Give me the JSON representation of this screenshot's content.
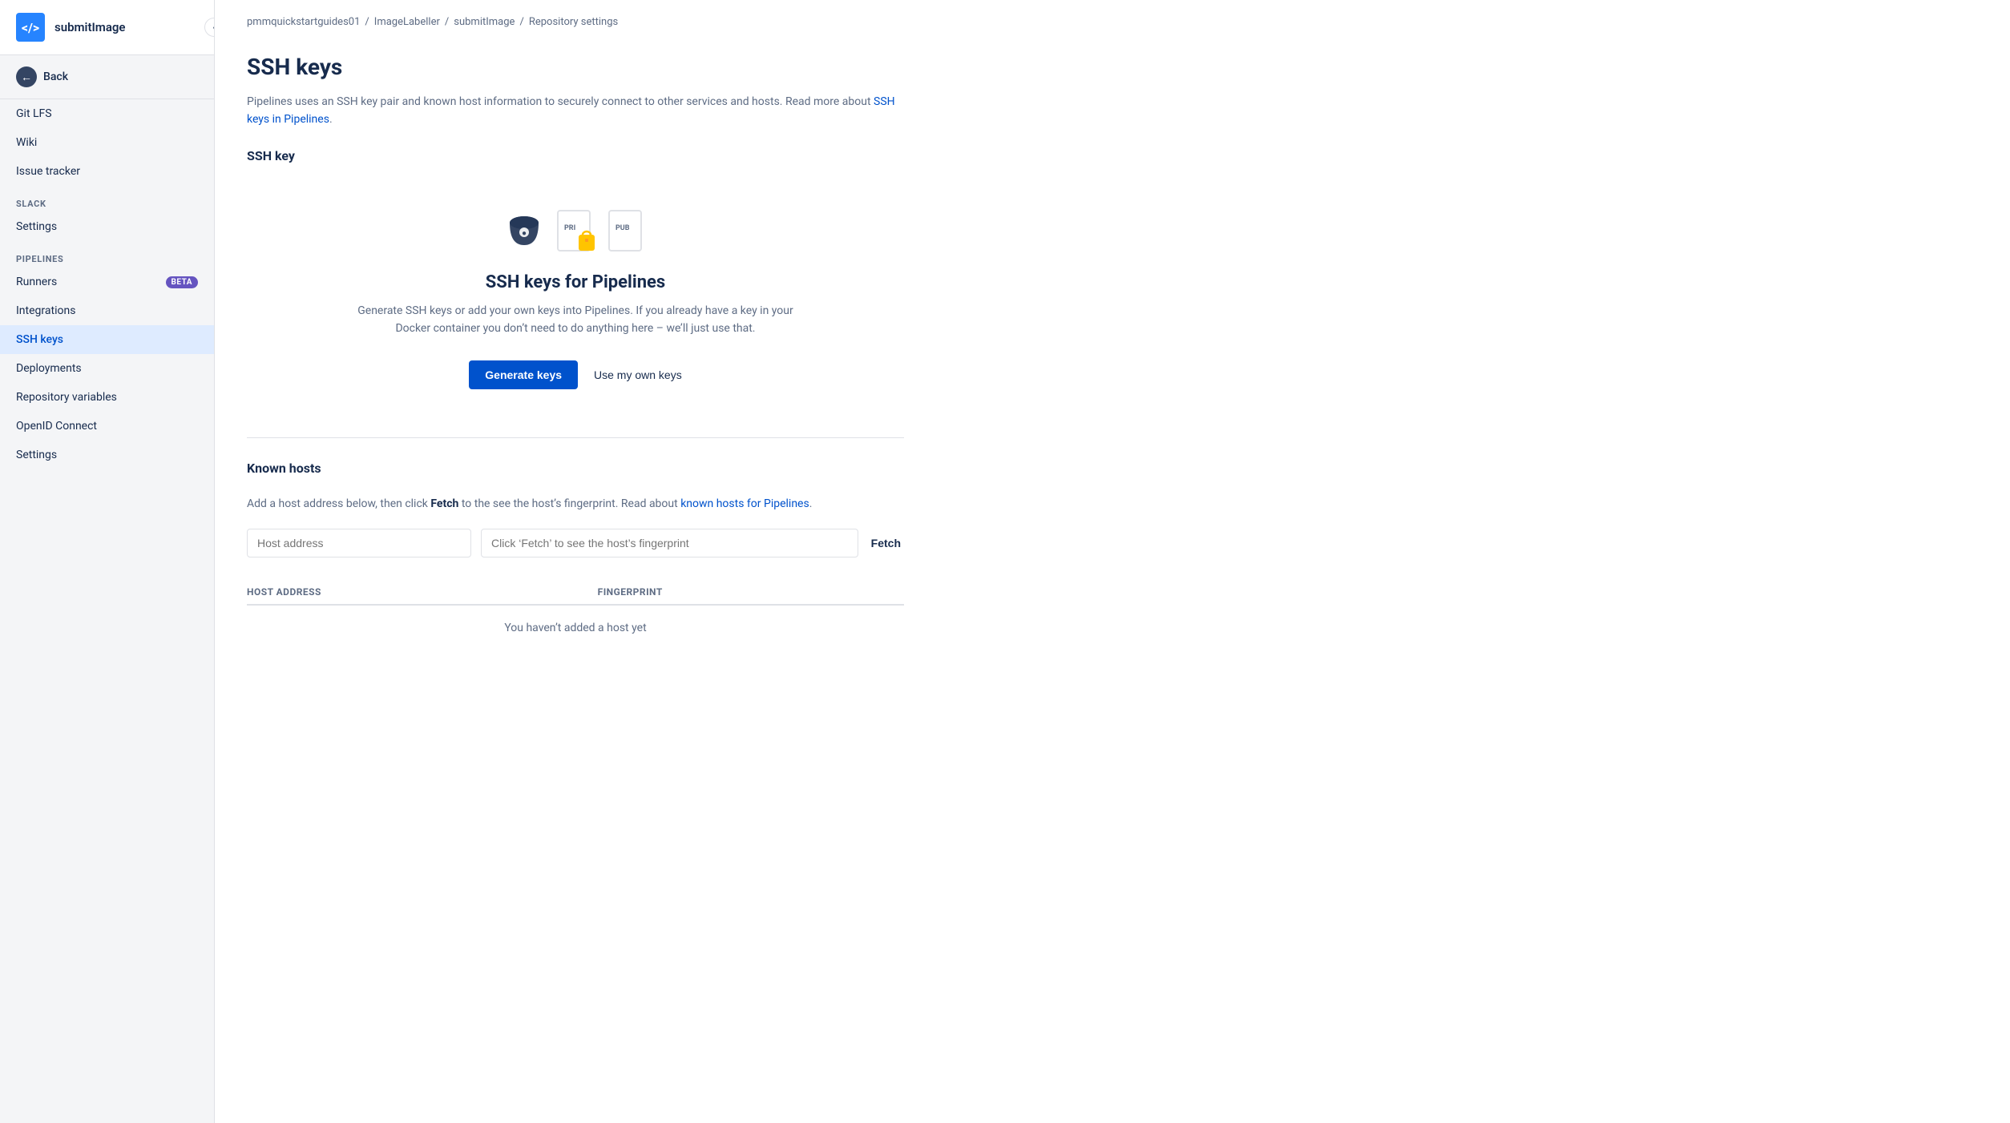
{
  "sidebar": {
    "logo_text": "</>",
    "repo_name": "submitImage",
    "toggle_icon": "‹",
    "back_label": "Back",
    "nav_items": [
      {
        "id": "git-lfs",
        "label": "Git LFS",
        "active": false,
        "section": null
      },
      {
        "id": "wiki",
        "label": "Wiki",
        "active": false,
        "section": null
      },
      {
        "id": "issue-tracker",
        "label": "Issue tracker",
        "active": false,
        "section": null
      },
      {
        "id": "slack-settings",
        "label": "Settings",
        "active": false,
        "section": "SLACK"
      },
      {
        "id": "runners",
        "label": "Runners",
        "active": false,
        "badge": "BETA",
        "section": "PIPELINES"
      },
      {
        "id": "integrations",
        "label": "Integrations",
        "active": false,
        "section": null
      },
      {
        "id": "ssh-keys",
        "label": "SSH keys",
        "active": true,
        "section": null
      },
      {
        "id": "deployments",
        "label": "Deployments",
        "active": false,
        "section": null
      },
      {
        "id": "repository-variables",
        "label": "Repository variables",
        "active": false,
        "section": null
      },
      {
        "id": "openid-connect",
        "label": "OpenID Connect",
        "active": false,
        "section": null
      },
      {
        "id": "settings",
        "label": "Settings",
        "active": false,
        "section": null
      }
    ]
  },
  "breadcrumb": {
    "items": [
      {
        "label": "pmmquickstartguides01",
        "link": true
      },
      {
        "label": "ImageLabeller",
        "link": true
      },
      {
        "label": "submitImage",
        "link": true
      },
      {
        "label": "Repository settings",
        "link": false
      }
    ],
    "separator": "/"
  },
  "page": {
    "title": "SSH keys",
    "description": "Pipelines uses an SSH key pair and known host information to securely connect to other services and hosts. Read more about",
    "description_link_text": "SSH keys in Pipelines",
    "description_end": "."
  },
  "ssh_key_section": {
    "label": "SSH key",
    "card_title": "SSH keys for Pipelines",
    "card_description": "Generate SSH keys or add your own keys into Pipelines. If you already have a key in your Docker container you don’t need to do anything here – we’ll just use that.",
    "generate_button": "Generate keys",
    "own_keys_button": "Use my own keys"
  },
  "known_hosts": {
    "title": "Known hosts",
    "description_before": "Add a host address below, then click",
    "fetch_bold": "Fetch",
    "description_after": "to the see the host’s fingerprint. Read about",
    "link_text": "known hosts for Pipelines",
    "description_end": ".",
    "host_address_placeholder": "Host address",
    "fingerprint_placeholder": "Click ‘Fetch’ to see the host’s fingerprint",
    "fetch_button": "Fetch",
    "table_headers": [
      "Host address",
      "Fingerprint"
    ],
    "empty_message": "You haven’t added a host yet"
  }
}
